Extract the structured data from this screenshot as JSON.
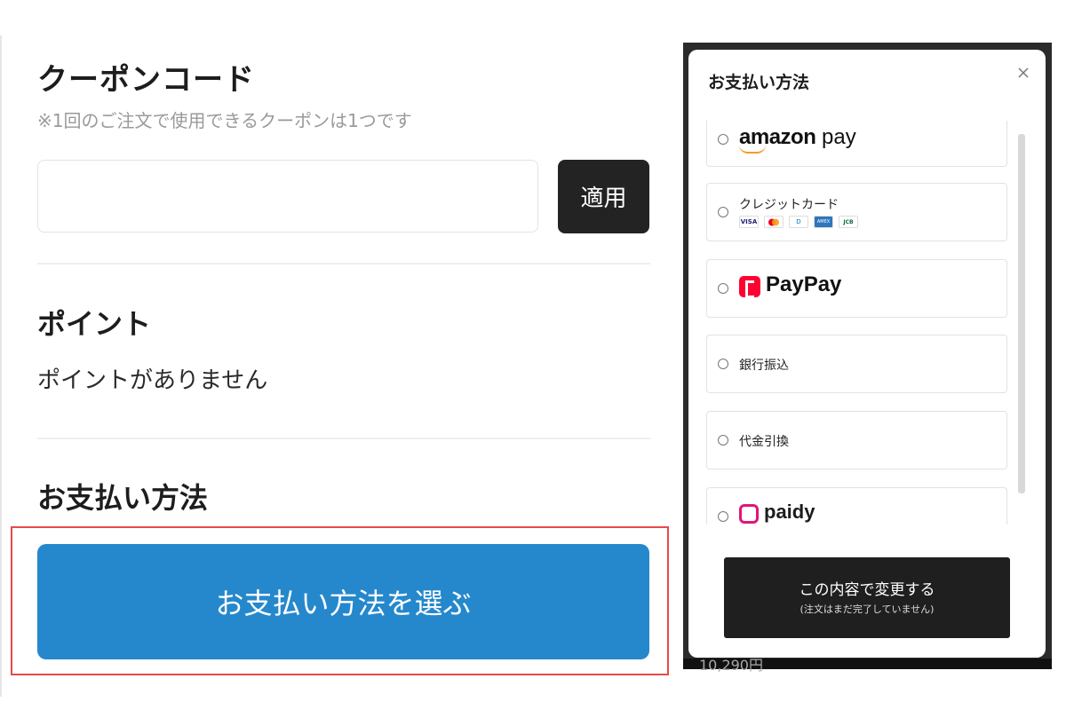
{
  "coupon": {
    "title": "クーポンコード",
    "note": "※1回のご注文で使用できるクーポンは1つです",
    "input_value": "",
    "apply_label": "適用"
  },
  "points": {
    "title": "ポイント",
    "message": "ポイントがありません"
  },
  "payment": {
    "title": "お支払い方法",
    "choose_button": "お支払い方法を選ぶ"
  },
  "modal": {
    "title": "お支払い方法",
    "close_icon": "close-icon",
    "options": [
      {
        "label": "amazon pay",
        "brand_bold": "amazon",
        "brand_light": "pay"
      },
      {
        "label": "クレジットカード",
        "cards": [
          "VISA",
          "MC",
          "D",
          "AMEX",
          "JCB"
        ]
      },
      {
        "label": "PayPay"
      },
      {
        "label": "銀行振込"
      },
      {
        "label": "代金引換"
      },
      {
        "label": "paidy"
      }
    ],
    "confirm_main": "この内容で変更する",
    "confirm_sub": "(注文はまだ完了していません)"
  },
  "background_text": "10,290円",
  "colors": {
    "primary_blue": "#2588cc",
    "dark_button": "#1f1f1f",
    "highlight_red": "#e84a4a",
    "paypay_red": "#ff0033",
    "paidy_pink": "#e0157a",
    "amazon_orange": "#f29a2e"
  }
}
